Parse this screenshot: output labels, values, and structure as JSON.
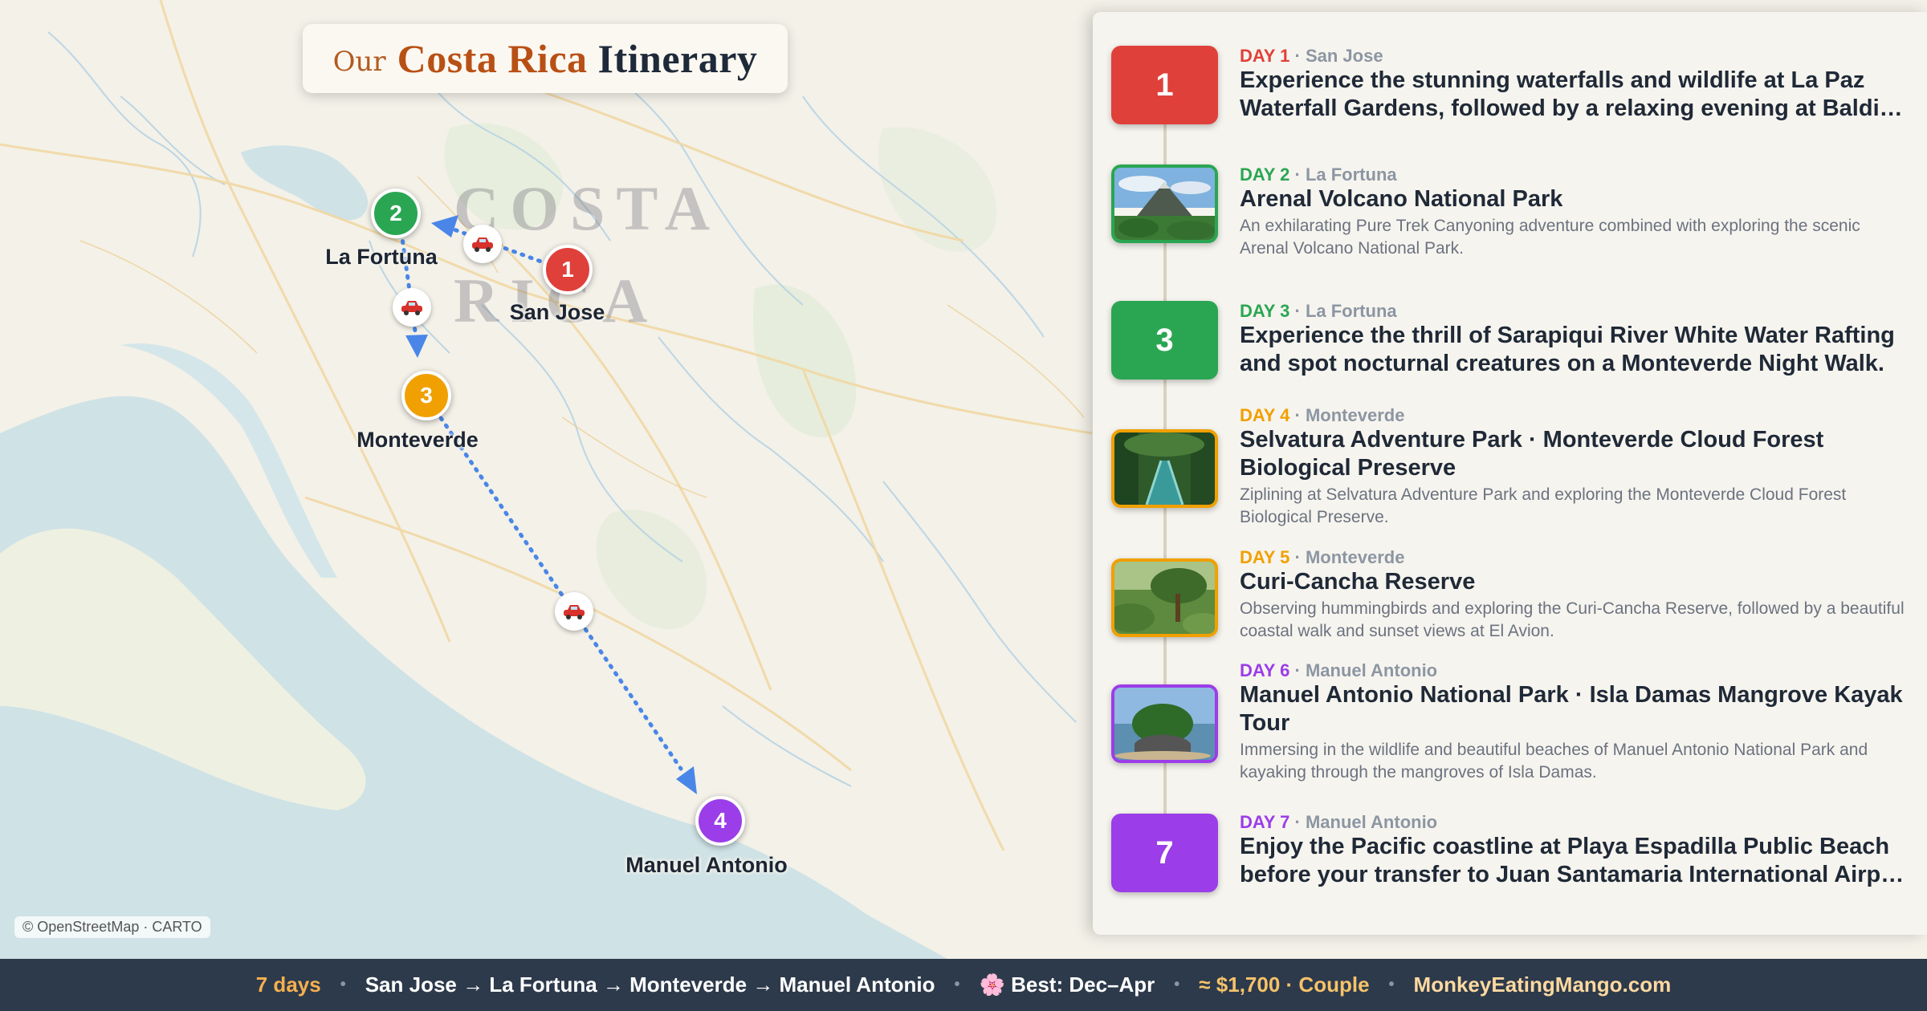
{
  "map": {
    "title": {
      "prefix": "Our",
      "highlight": "Costa Rica",
      "rest": "Itinerary"
    },
    "country_label": {
      "line1": "COSTA",
      "line2": "RICA"
    },
    "attribution": "© OpenStreetMap · CARTO",
    "stops": [
      {
        "number": "1",
        "name": "San Jose",
        "color": "#e0403a"
      },
      {
        "number": "2",
        "name": "La Fortuna",
        "color": "#2aa653"
      },
      {
        "number": "3",
        "name": "Monteverde",
        "color": "#f0a000"
      },
      {
        "number": "4",
        "name": "Manuel Antonio",
        "color": "#9b3de8"
      }
    ],
    "route_color": "#4a86e8",
    "transport_icon": "car-icon"
  },
  "itinerary": [
    {
      "day": "DAY 1",
      "location": "San Jose",
      "color": "#e0403a",
      "badge": "1",
      "title": "Experience the stunning waterfalls and wildlife at La Paz Waterfall Gardens, followed by a relaxing evening at Baldi…",
      "description": ""
    },
    {
      "day": "DAY 2",
      "location": "La Fortuna",
      "color": "#2aa653",
      "photo": "volcano-photo",
      "title": "Arenal Volcano National Park",
      "description": "An exhilarating Pure Trek Canyoning adventure combined with exploring the scenic Arenal Volcano National Park."
    },
    {
      "day": "DAY 3",
      "location": "La Fortuna",
      "color": "#2aa653",
      "badge": "3",
      "title": "Experience the thrill of Sarapiqui River White Water Rafting and spot nocturnal creatures on a Monteverde Night Walk.",
      "description": ""
    },
    {
      "day": "DAY 4",
      "location": "Monteverde",
      "color": "#f0a000",
      "photo": "hanging-bridge-photo",
      "title": "Selvatura Adventure Park · Monteverde Cloud Forest Biological Preserve",
      "description": "Ziplining at Selvatura Adventure Park and exploring the Monteverde Cloud Forest Biological Preserve."
    },
    {
      "day": "DAY 5",
      "location": "Monteverde",
      "color": "#f0a000",
      "photo": "forest-tree-photo",
      "title": "Curi-Cancha Reserve",
      "description": "Observing hummingbirds and exploring the Curi-Cancha Reserve, followed by a beautiful coastal walk and sunset views at El Avion."
    },
    {
      "day": "DAY 6",
      "location": "Manuel Antonio",
      "color": "#9b3de8",
      "photo": "island-beach-photo",
      "title": "Manuel Antonio National Park · Isla Damas Mangrove Kayak Tour",
      "description": "Immersing in the wildlife and beautiful beaches of Manuel Antonio National Park and kayaking through the mangroves of Isla Damas."
    },
    {
      "day": "DAY 7",
      "location": "Manuel Antonio",
      "color": "#9b3de8",
      "badge": "7",
      "title": "Enjoy the Pacific coastline at Playa Espadilla Public Beach before your transfer to Juan Santamaria International Airp…",
      "description": ""
    }
  ],
  "footer": {
    "duration": "7 days",
    "route": "San Jose → La Fortuna → Monteverde → Manuel Antonio",
    "best_season": "🌸 Best: Dec–Apr",
    "budget": "≈ $1,700 · Couple",
    "site": "MonkeyEatingMango.com",
    "separator": "•"
  }
}
